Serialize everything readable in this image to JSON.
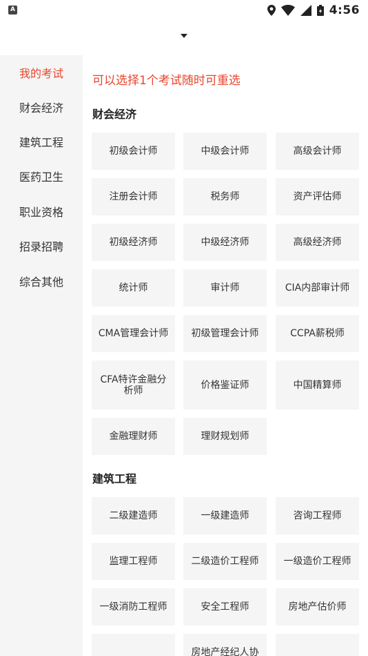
{
  "status": {
    "time": "4:56",
    "left_icon": "A"
  },
  "sidebar": {
    "items": [
      "我的考试",
      "财会经济",
      "建筑工程",
      "医药卫生",
      "职业资格",
      "招录招聘",
      "综合其他"
    ],
    "active_index": 0
  },
  "content": {
    "hint": "可以选择1个考试随时可重选",
    "sections": [
      {
        "title": "财会经济",
        "items": [
          "初级会计师",
          "中级会计师",
          "高级会计师",
          "注册会计师",
          "税务师",
          "资产评估师",
          "初级经济师",
          "中级经济师",
          "高级经济师",
          "统计师",
          "审计师",
          "CIA内部审计师",
          "CMA管理会计师",
          "初级管理会计师",
          "CCPA薪税师",
          "CFA特许金融分析师",
          "价格鉴证师",
          "中国精算师",
          "金融理财师",
          "理财规划师"
        ]
      },
      {
        "title": "建筑工程",
        "items": [
          "二级建造师",
          "一级建造师",
          "咨询工程师",
          "监理工程师",
          "二级造价工程师",
          "一级造价工程师",
          "一级消防工程师",
          "安全工程师",
          "房地产估价师",
          "",
          "房地产经纪人协",
          ""
        ]
      }
    ]
  },
  "colors": {
    "accent": "#e8452c",
    "sidebar_bg": "#f5f5f5",
    "cell_bg": "#f5f5f5"
  }
}
